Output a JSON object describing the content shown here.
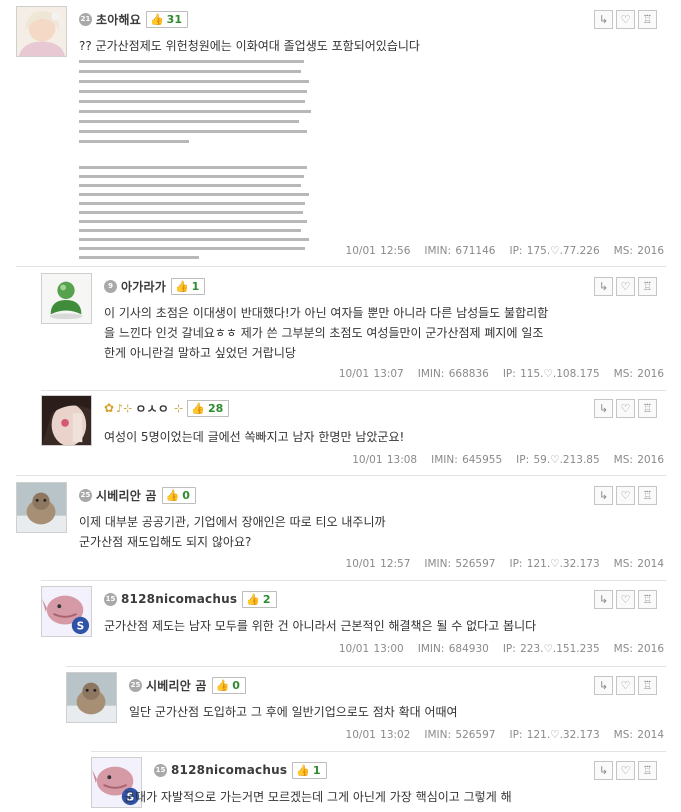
{
  "comments": [
    {
      "nick": "초아해요",
      "level": "21",
      "likes": "31",
      "text": "?? 군가산점제도 위헌청원에는 이화여대 졸업생도 포함되어있습니다",
      "time": "10/01 12:56",
      "imin": "IMIN: 671146",
      "ip": "IP: 175.♡.77.226",
      "ms": "MS: 2016",
      "image_alt": "scanned-document-screenshot"
    },
    {
      "nick": "아가라가",
      "level": "9",
      "likes": "1",
      "text_lines": [
        "이 기사의 초점은 이대생이 반대했다!가 아닌 여자들 뿐만 아니라 다른 남성들도 불합리함",
        "을 느낀다 인것 갈네요ㅎㅎ 제가 쓴 그부분의 초점도 여성들만이 군가산점제 폐지에 일조",
        "한게 아니란걸 말하고 싶었던 거랍니당"
      ],
      "time": "10/01 13:07",
      "imin": "IMIN: 668836",
      "ip": "IP: 115.♡.108.175",
      "ms": "MS: 2016"
    },
    {
      "nick": "ㅇㅅㅇ",
      "nick_prefix": "🌼",
      "level": "",
      "likes": "28",
      "text": "여성이 5명이었는데 글에선 쏙빠지고 남자 한명만 남았군요!",
      "time": "10/01 13:08",
      "imin": "IMIN: 645955",
      "ip": "IP: 59.♡.213.85",
      "ms": "MS: 2016"
    },
    {
      "nick": "시베리안 곰",
      "level": "25",
      "likes": "0",
      "text_lines": [
        "이제 대부분 공공기관, 기업에서 장애인은 따로 티오 내주니까",
        "군가산점 재도입해도 되지 않아요?"
      ],
      "time": "10/01 12:57",
      "imin": "IMIN: 526597",
      "ip": "IP: 121.♡.32.173",
      "ms": "MS: 2014"
    },
    {
      "nick": "8128nicomachus",
      "level": "15",
      "likes": "2",
      "text": "군가산점 제도는 남자 모두를 위한 건 아니라서 근본적인 해결책은 될 수 없다고 봅니다",
      "time": "10/01 13:00",
      "imin": "IMIN: 684930",
      "ip": "IP: 223.♡.151.235",
      "ms": "MS: 2016"
    },
    {
      "nick": "시베리안 곰",
      "level": "25",
      "likes": "0",
      "text": "일단 군가산점 도입하고 그 후에 일반기업으로도 점차 확대 어때여",
      "time": "10/01 13:02",
      "imin": "IMIN: 526597",
      "ip": "IP: 121.♡.32.173",
      "ms": "MS: 2014"
    },
    {
      "nick": "8128nicomachus",
      "level": "15",
      "likes": "1",
      "text": "군대가 자발적으로 가는거면 모르겠는데 그게 아닌게 가장 핵심이고 그렇게 해"
    }
  ],
  "buttons": {
    "reply_icon": "reply-arrow-icon",
    "like_icon": "heart-icon",
    "report_icon": "siren-icon"
  },
  "colors": {
    "likes_text": "#2e8b2e",
    "meta_text": "#8a8a8a",
    "separator": "#e3e3e3"
  }
}
